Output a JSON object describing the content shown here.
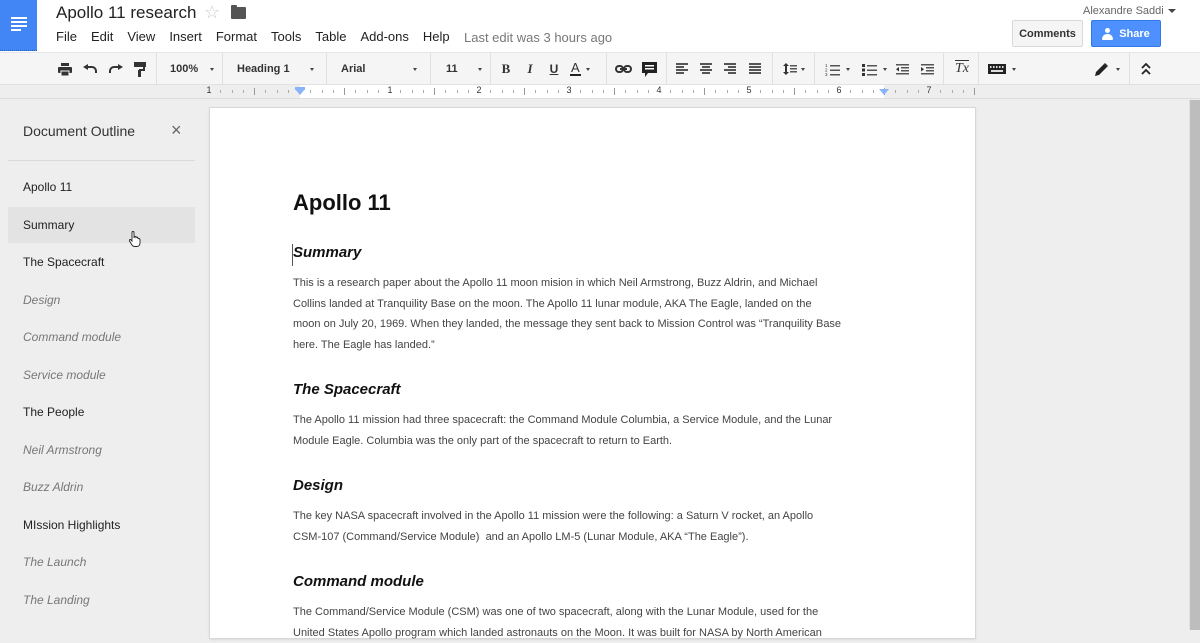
{
  "app": {
    "title": "Apollo 11 research",
    "accent_color": "#4285f4",
    "last_edit": "Last edit was 3 hours ago",
    "user_name": "Alexandre Saddi",
    "comments_label": "Comments",
    "share_label": "Share"
  },
  "menubar": {
    "items": [
      {
        "label": "File"
      },
      {
        "label": "Edit"
      },
      {
        "label": "View"
      },
      {
        "label": "Insert"
      },
      {
        "label": "Format"
      },
      {
        "label": "Tools"
      },
      {
        "label": "Table"
      },
      {
        "label": "Add-ons"
      },
      {
        "label": "Help"
      }
    ]
  },
  "toolbar": {
    "zoom": "100%",
    "style": "Heading 1",
    "font": "Arial",
    "font_size": "11",
    "bold_glyph": "B",
    "italic_glyph": "I",
    "underline_glyph": "U",
    "text_color_glyph": "A",
    "clear_format_glyph": "Tx",
    "icons": [
      "print-icon",
      "undo-icon",
      "redo-icon",
      "paint-format-icon",
      "link-icon",
      "comment-icon",
      "align-left-icon",
      "align-center-icon",
      "align-right-icon",
      "justify-icon",
      "line-spacing-icon",
      "numbered-list-icon",
      "bulleted-list-icon",
      "decrease-indent-icon",
      "increase-indent-icon",
      "clear-formatting-icon",
      "input-tools-icon",
      "editing-mode-icon",
      "collapse-menus-icon"
    ]
  },
  "ruler": {
    "labels": [
      "1",
      "1",
      "2",
      "3",
      "4",
      "5",
      "6",
      "7"
    ]
  },
  "outline": {
    "title": "Document Outline",
    "close_glyph": "×",
    "items": [
      {
        "label": "Apollo 11",
        "level": 1,
        "active": false
      },
      {
        "label": "Summary",
        "level": 1,
        "active": true
      },
      {
        "label": "The Spacecraft",
        "level": 1,
        "active": false
      },
      {
        "label": "Design",
        "level": 3,
        "active": false
      },
      {
        "label": "Command module",
        "level": 3,
        "active": false
      },
      {
        "label": "Service module",
        "level": 3,
        "active": false
      },
      {
        "label": "The People",
        "level": 1,
        "active": false
      },
      {
        "label": "Neil Armstrong",
        "level": 3,
        "active": false
      },
      {
        "label": "Buzz Aldrin",
        "level": 3,
        "active": false
      },
      {
        "label": "MIssion Highlights",
        "level": 1,
        "active": false
      },
      {
        "label": "The Launch",
        "level": 3,
        "active": false
      },
      {
        "label": "The Landing",
        "level": 3,
        "active": false
      }
    ]
  },
  "document": {
    "title": "Apollo 11",
    "sections": [
      {
        "heading": "Summary",
        "lines": [
          "This is a research paper about the Apollo 11 moon mision in which Neil Armstrong, Buzz Aldrin, and Michael",
          "Collins landed at Tranquility Base on the moon. The Apollo 11 lunar module, AKA The Eagle, landed on the",
          "moon on July 20, 1969. When they landed, the message they sent back to Mission Control was “Tranquility Base",
          "here. The Eagle has landed.”"
        ]
      },
      {
        "heading": "The Spacecraft",
        "lines": [
          "The Apollo 11 mission had three spacecraft: the Command Module Columbia, a Service Module, and the Lunar",
          "Module Eagle. Columbia was the only part of the spacecraft to return to Earth."
        ]
      },
      {
        "heading": "Design",
        "lines": [
          "The key NASA spacecraft involved in the Apollo 11 mission were the following: a Saturn V rocket, an Apollo",
          "CSM-107 (Command/Service Module)  and an Apollo LM-5 (Lunar Module, AKA “The Eagle”)."
        ]
      },
      {
        "heading": "Command module",
        "lines": [
          "The Command/Service Module (CSM) was one of two spacecraft, along with the Lunar Module, used for the",
          "United States Apollo program which landed astronauts on the Moon. It was built for NASA by North American"
        ]
      }
    ]
  }
}
